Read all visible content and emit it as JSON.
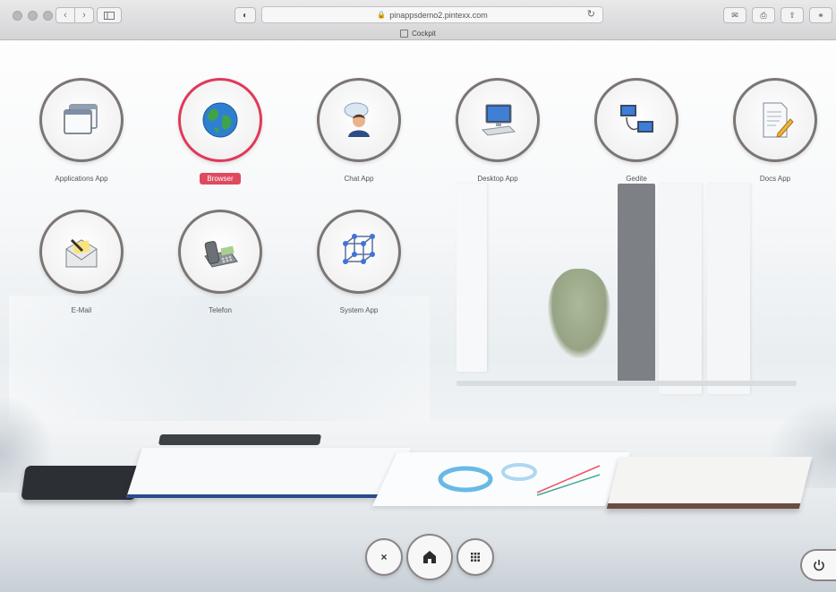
{
  "browser": {
    "url": "pinappsdemo2.pintexx.com",
    "tab_title": "Cockpit"
  },
  "apps_row1": [
    {
      "label": "Applications App",
      "icon": "windows-icon"
    },
    {
      "label": "Browser",
      "icon": "globe-icon",
      "selected": true
    },
    {
      "label": "Chat App",
      "icon": "chat-user-icon"
    },
    {
      "label": "Desktop App",
      "icon": "computer-icon"
    },
    {
      "label": "Gedite",
      "icon": "network-computers-icon"
    },
    {
      "label": "Docs App",
      "icon": "document-pencil-icon"
    }
  ],
  "apps_row2": [
    {
      "label": "E-Mail",
      "icon": "mail-icon"
    },
    {
      "label": "Telefon",
      "icon": "telephone-icon"
    },
    {
      "label": "System App",
      "icon": "cube-network-icon"
    }
  ],
  "dock": {
    "close": "close-icon",
    "home": "home-icon",
    "apps": "grid-icon",
    "power": "power-icon"
  },
  "colors": {
    "accent": "#e0395a",
    "circle_border": "#7b7574"
  }
}
